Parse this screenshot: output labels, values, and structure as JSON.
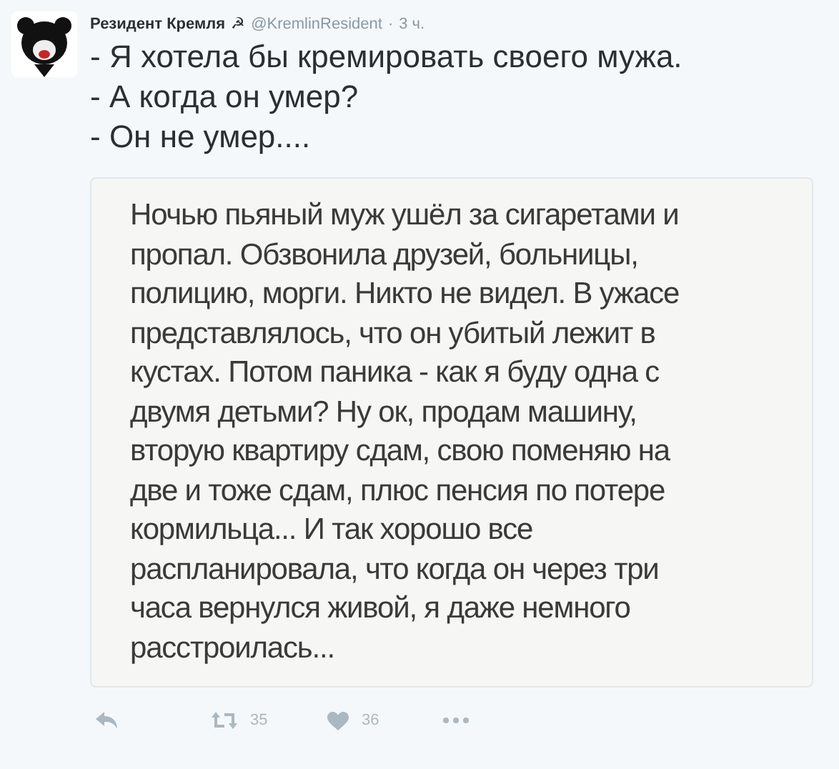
{
  "tweet": {
    "author_name": "Резидент Кремля",
    "author_badge": "☭",
    "handle": "@KremlinResident",
    "separator": "·",
    "time": "3 ч.",
    "lines": [
      "- Я хотела бы кремировать своего мужа.",
      "- А когда он умер?",
      "- Он не умер...."
    ],
    "image_text_lines": [
      "Ночью пьяный муж ушёл за сигаретами и",
      "пропал. Обзвонила друзей, больницы,",
      "полицию, морги. Никто не видел. В ужасе",
      "представлялось, что он убитый лежит в",
      "кустах. Потом паника - как я буду одна с",
      "двумя детьми? Ну ок, продам машину,",
      "вторую квартиру сдам, свою поменяю на",
      "две и тоже сдам, плюс пенсия по потере",
      "кормильца... И так хорошо все",
      "распланировала, что когда он через три",
      "часа вернулся живой, я даже немного",
      "расстроилась..."
    ],
    "actions": [
      {
        "kind": "reply"
      },
      {
        "kind": "retweet",
        "count": "35"
      },
      {
        "kind": "like",
        "count": "36"
      },
      {
        "kind": "more"
      }
    ]
  }
}
